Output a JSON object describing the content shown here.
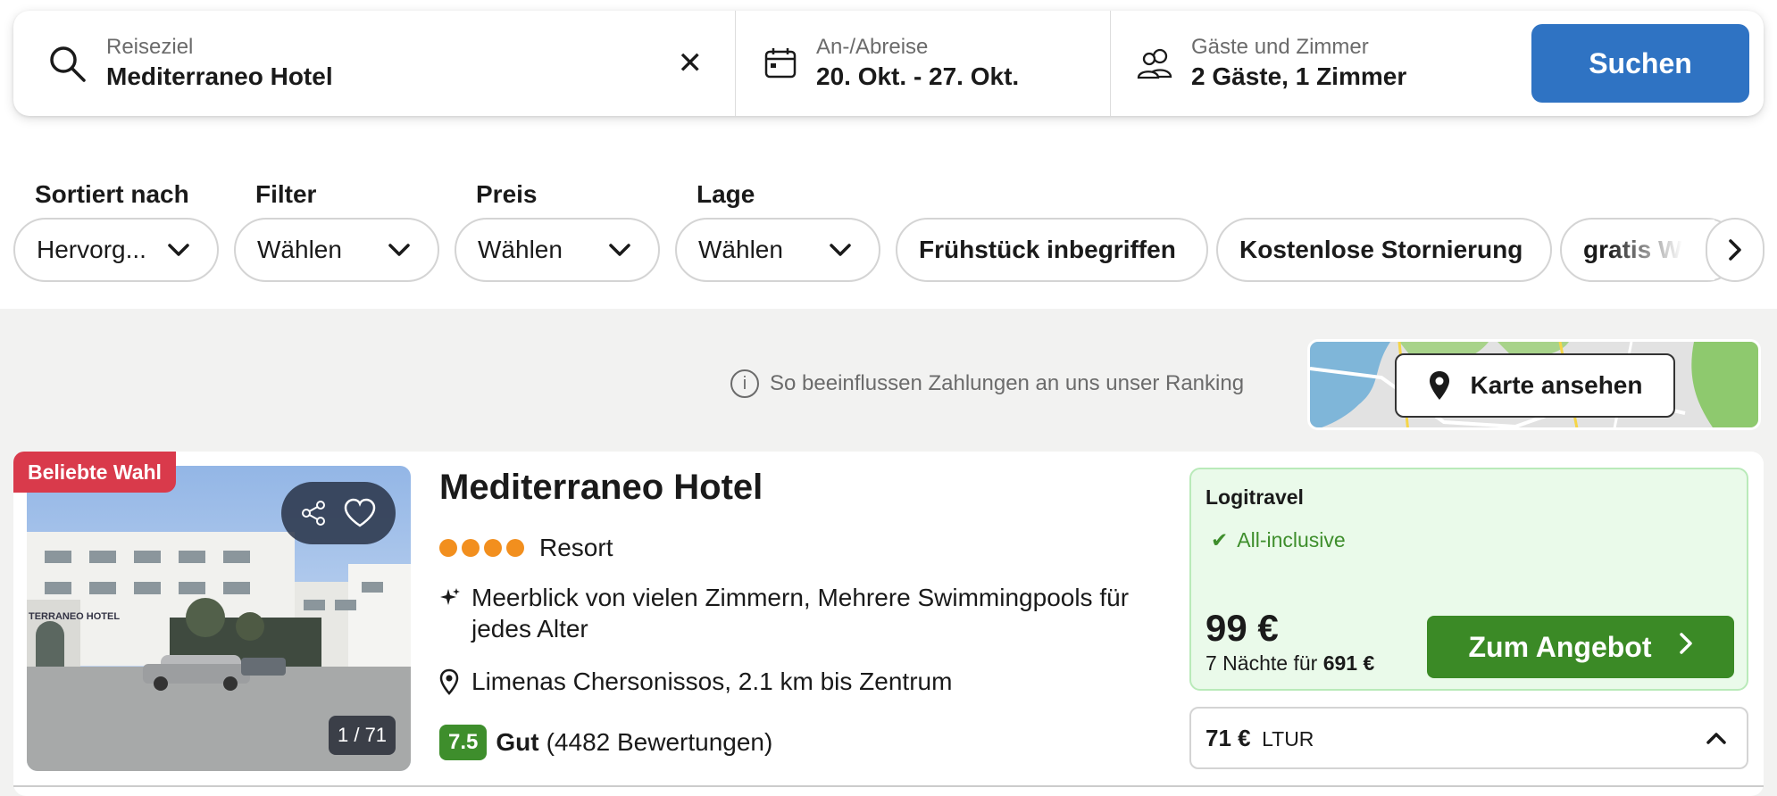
{
  "search": {
    "destination_label": "Reiseziel",
    "destination_value": "Mediterraneo Hotel",
    "dates_label": "An-/Abreise",
    "dates_value": "20. Okt. - 27. Okt.",
    "guests_label": "Gäste und Zimmer",
    "guests_value": "2 Gäste, 1 Zimmer",
    "submit_label": "Suchen",
    "clear_glyph": "✕"
  },
  "filters": {
    "sort": {
      "title": "Sortiert nach",
      "value": "Hervorg..."
    },
    "filter": {
      "title": "Filter",
      "value": "Wählen"
    },
    "price": {
      "title": "Preis",
      "value": "Wählen"
    },
    "location": {
      "title": "Lage",
      "value": "Wählen"
    },
    "chips": [
      "Frühstück inbegriffen",
      "Kostenlose Stornierung",
      "gratis WLAN"
    ]
  },
  "ranking_note": "So beeinflussen Zahlungen an uns unser Ranking",
  "map": {
    "button_label": "Karte ansehen"
  },
  "hotel": {
    "badge": "Beliebte Wahl",
    "name": "Mediterraneo Hotel",
    "star_count": 4,
    "type": "Resort",
    "features": "Meerblick von vielen Zimmern, Mehrere Swimmingpools für jedes Alter",
    "location": "Limenas Chersonissos, 2.1 km bis Zentrum",
    "rating_score": "7.5",
    "rating_word": "Gut",
    "rating_count": "(4482 Bewertungen)",
    "photo_counter": "1 / 71",
    "photo_sign": "TERRANEO HOTEL"
  },
  "offer": {
    "provider": "Logitravel",
    "board": "All-inclusive",
    "price": "99 €",
    "total_prefix": "7 Nächte für",
    "total_value": "691 €",
    "button_label": "Zum Angebot"
  },
  "alt_offer": {
    "price": "71 €",
    "provider": "LTUR"
  },
  "colors": {
    "primary_blue": "#2f73c3",
    "deal_green": "#3b8a26",
    "badge_red": "#d93a4b",
    "star_orange": "#f28f1e"
  }
}
